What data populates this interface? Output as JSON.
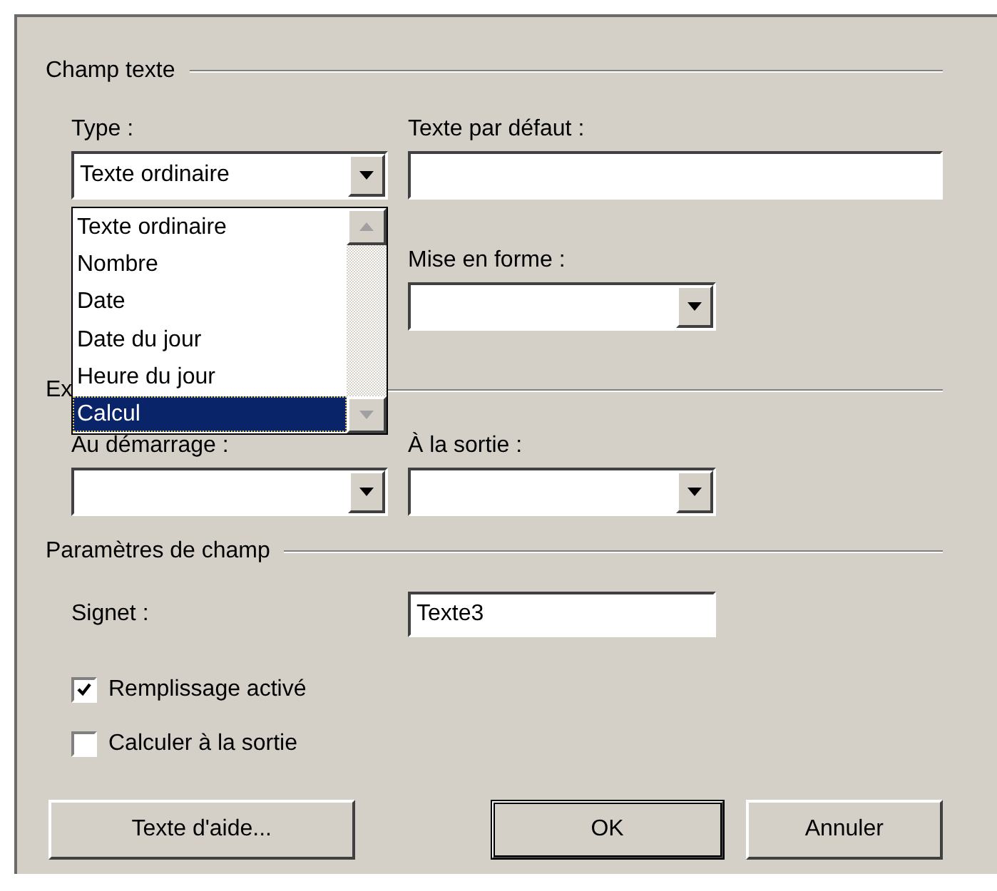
{
  "champ_texte": {
    "title": "Champ texte",
    "type_label": "Type :",
    "type_value": "Texte ordinaire",
    "default_label": "Texte par défaut :",
    "format_label": "Mise en forme :",
    "type_list": [
      {
        "label": "Texte ordinaire",
        "selected": false
      },
      {
        "label": "Nombre",
        "selected": false
      },
      {
        "label": "Date",
        "selected": false
      },
      {
        "label": "Date du jour",
        "selected": false
      },
      {
        "label": "Heure du jour",
        "selected": false
      },
      {
        "label": "Calcul",
        "selected": true
      }
    ]
  },
  "macro": {
    "title": "Ex",
    "entry_label": "Au démarrage :",
    "exit_label": "À la sortie :"
  },
  "params": {
    "title": "Paramètres de champ",
    "bookmark_label": "Signet :",
    "bookmark_value": "Texte3",
    "checkboxes": [
      {
        "label": "Remplissage activé",
        "checked": true
      },
      {
        "label": "Calculer à la sortie",
        "checked": false
      }
    ]
  },
  "buttons": [
    {
      "label": "Texte d'aide...",
      "default": false
    },
    {
      "label": "OK",
      "default": true
    },
    {
      "label": "Annuler",
      "default": false
    }
  ]
}
